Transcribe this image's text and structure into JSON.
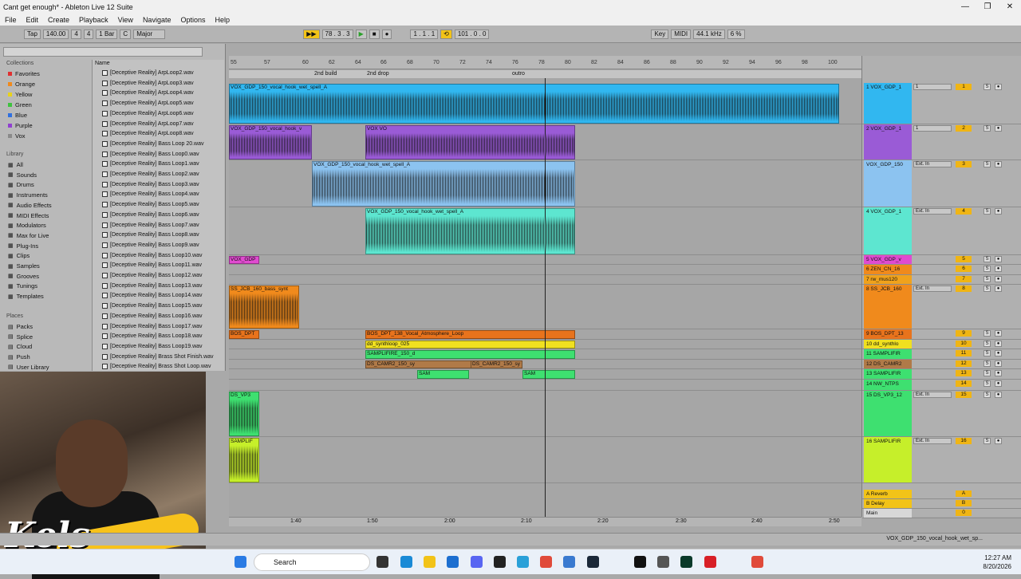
{
  "window": {
    "title": "Cant get enough* - Ableton Live 12 Suite"
  },
  "menu": [
    "File",
    "Edit",
    "Create",
    "Playback",
    "View",
    "Navigate",
    "Options",
    "Help"
  ],
  "transport": {
    "tap": "Tap",
    "tempo": "140.00",
    "sig_num": "4",
    "sig_den": "4",
    "quant": "1 Bar",
    "key": "C",
    "scale": "Major",
    "position": "78 . 3 . 3",
    "loop_start": "1 . 1 . 1",
    "loop_len": "101 . 0 . 0",
    "key_label": "Key",
    "midi_label": "MIDI",
    "sample_rate": "44.1 kHz",
    "cpu": "6 %"
  },
  "browser": {
    "collections_label": "Collections",
    "collections": [
      {
        "label": "Favorites",
        "color": "#e03030"
      },
      {
        "label": "Orange",
        "color": "#f08a1c"
      },
      {
        "label": "Yellow",
        "color": "#e8d21a"
      },
      {
        "label": "Green",
        "color": "#3ec23e"
      },
      {
        "label": "Blue",
        "color": "#2f6fe0"
      },
      {
        "label": "Purple",
        "color": "#9040d0"
      },
      {
        "label": "Vox",
        "color": "#8a8a8a"
      }
    ],
    "library_label": "Library",
    "library": [
      "All",
      "Sounds",
      "Drums",
      "Instruments",
      "Audio Effects",
      "MIDI Effects",
      "Modulators",
      "Max for Live",
      "Plug-Ins",
      "Clips",
      "Samples",
      "Grooves",
      "Tunings",
      "Templates"
    ],
    "places_label": "Places",
    "places": [
      "Packs",
      "Splice",
      "Cloud",
      "Push",
      "User Library"
    ],
    "name_header": "Name",
    "files": [
      "[Deceptive Reality] ArpLoop2.wav",
      "[Deceptive Reality] ArpLoop3.wav",
      "[Deceptive Reality] ArpLoop4.wav",
      "[Deceptive Reality] ArpLoop5.wav",
      "[Deceptive Reality] ArpLoop6.wav",
      "[Deceptive Reality] ArpLoop7.wav",
      "[Deceptive Reality] ArpLoop8.wav",
      "[Deceptive Reality] Bass Loop 20.wav",
      "[Deceptive Reality] Bass Loop0.wav",
      "[Deceptive Reality] Bass Loop1.wav",
      "[Deceptive Reality] Bass Loop2.wav",
      "[Deceptive Reality] Bass Loop3.wav",
      "[Deceptive Reality] Bass Loop4.wav",
      "[Deceptive Reality] Bass Loop5.wav",
      "[Deceptive Reality] Bass Loop6.wav",
      "[Deceptive Reality] Bass Loop7.wav",
      "[Deceptive Reality] Bass Loop8.wav",
      "[Deceptive Reality] Bass Loop9.wav",
      "[Deceptive Reality] Bass Loop10.wav",
      "[Deceptive Reality] Bass Loop11.wav",
      "[Deceptive Reality] Bass Loop12.wav",
      "[Deceptive Reality] Bass Loop13.wav",
      "[Deceptive Reality] Bass Loop14.wav",
      "[Deceptive Reality] Bass Loop15.wav",
      "[Deceptive Reality] Bass Loop16.wav",
      "[Deceptive Reality] Bass Loop17.wav",
      "[Deceptive Reality] Bass Loop18.wav",
      "[Deceptive Reality] Bass Loop19.wav",
      "[Deceptive Reality] Brass Shot Finish.wav",
      "[Deceptive Reality] Brass Shot Loop.wav"
    ]
  },
  "webcam": {
    "logo": "Kels"
  },
  "ruler": {
    "bars": [
      "55",
      "57",
      "60",
      "62",
      "64",
      "66",
      "68",
      "70",
      "72",
      "74",
      "76",
      "78",
      "80",
      "82",
      "84",
      "86",
      "88",
      "90",
      "92",
      "94",
      "96",
      "98",
      "100"
    ],
    "time_sig": "4/4"
  },
  "locators": [
    "2nd build",
    "2nd drop",
    "outro"
  ],
  "tracks": [
    {
      "mix_name": "1 VOX_GDP_1",
      "color": "#31b7f0",
      "num": "1",
      "input": "1",
      "clip_labels": [
        "VOX_GDP_150_vocal_hook_wet_spell_A"
      ]
    },
    {
      "mix_name": "2 VOX_GDP_1",
      "color": "#9a5bd6",
      "num": "2",
      "input": "1",
      "clip_labels": [
        "VOX_GDP_150_vocal_hook_v",
        "VOX VO",
        "VOX_GDP_150_vo"
      ]
    },
    {
      "mix_name": "VOX_GDP_150",
      "color": "#8cc3f0",
      "num": "3",
      "input": "Ext. In",
      "clip_labels": [
        "VOX_GDP_150_vocal_hook_wet_spell_A"
      ]
    },
    {
      "mix_name": "4 VOX_GDP_1",
      "color": "#5de6d0",
      "num": "4",
      "input": "Ext. In",
      "clip_labels": [
        "VOX_GDP_150_vocal_hook_wet_spell_A"
      ]
    },
    {
      "mix_name": "5 VOX_GDP_v",
      "color": "#e04bd0",
      "num": "5",
      "input": "",
      "clip_labels": [
        "VOX_GDP"
      ]
    },
    {
      "mix_name": "6 ZEN_CN_16",
      "color": "#f08a1c",
      "num": "6",
      "input": "",
      "clip_labels": []
    },
    {
      "mix_name": "7 rw_mus120",
      "color": "#f0a21c",
      "num": "7",
      "input": "",
      "clip_labels": []
    },
    {
      "mix_name": "8 SS_JCB_160",
      "color": "#f08a1c",
      "num": "8",
      "input": "Ext. In",
      "clip_labels": [
        "SS_JCB_160_bass_synt"
      ]
    },
    {
      "mix_name": "9 BOS_DPT_13",
      "color": "#e8731c",
      "num": "9",
      "input": "",
      "clip_labels": [
        "BOS_DPT",
        "BOS_DPT_138_Vocal_Atmosphere_Loop"
      ]
    },
    {
      "mix_name": "10 dd_synthlo",
      "color": "#f0e020",
      "num": "10",
      "input": "",
      "clip_labels": [
        "dd_synthloop_025"
      ]
    },
    {
      "mix_name": "11 SAMPLIFIR",
      "color": "#3ee070",
      "num": "11",
      "input": "",
      "clip_labels": [
        "SAMPLIFIRE_150_d"
      ]
    },
    {
      "mix_name": "12 DS_CAMR2",
      "color": "#b07a48",
      "num": "12",
      "input": "",
      "clip_labels": [
        "DS_CAMR2_150_sy"
      ]
    },
    {
      "mix_name": "13 SAMPLIFIR",
      "color": "#3ee070",
      "num": "13",
      "input": "",
      "clip_labels": [
        "SAM"
      ]
    },
    {
      "mix_name": "14 NW_NTPS",
      "color": "#3ee070",
      "num": "14",
      "input": "",
      "clip_labels": []
    },
    {
      "mix_name": "15 DS_VP3_12",
      "color": "#3ee070",
      "num": "15",
      "input": "Ext. In",
      "clip_labels": [
        "DS_VP3"
      ]
    },
    {
      "mix_name": "16 SAMPLIFIR",
      "color": "#c6ef2a",
      "num": "16",
      "input": "Ext. In",
      "clip_labels": [
        "SAMPLIF"
      ]
    }
  ],
  "returns": [
    {
      "name": "A Reverb",
      "num": "A"
    },
    {
      "name": "B Delay",
      "num": "B"
    },
    {
      "name": "Main",
      "num": "0"
    }
  ],
  "time_marks": [
    "1:40",
    "1:50",
    "2:00",
    "2:10",
    "2:20",
    "2:30",
    "2:40",
    "2:50"
  ],
  "status": {
    "selected": "VOX_GDP_150_vocal_hook_wet_sp..."
  },
  "taskbar": {
    "search": "Search",
    "time": "12:27 AM",
    "date": "8/20/2026"
  }
}
